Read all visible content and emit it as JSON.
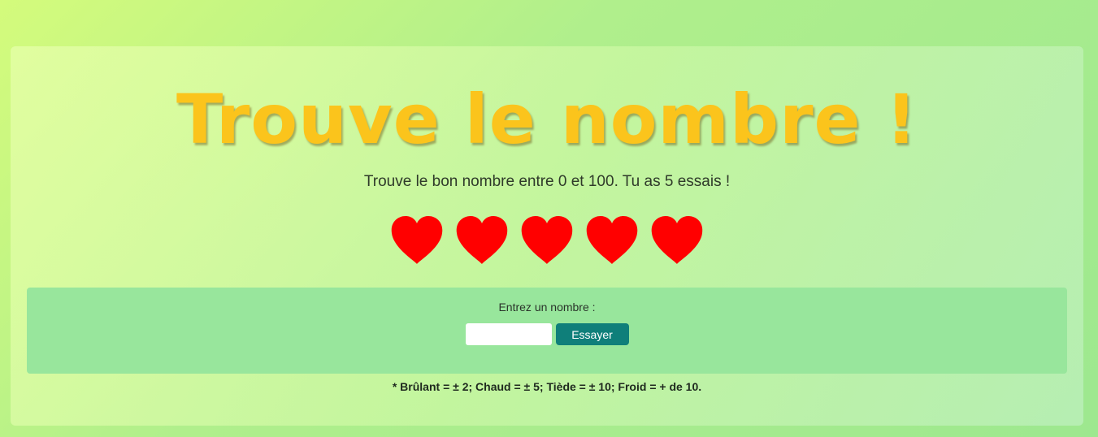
{
  "game": {
    "title": "Trouve le nombre !",
    "subtitle": "Trouve le bon nombre entre 0 et 100. Tu as 5 essais !",
    "lives": {
      "remaining": 5,
      "total": 5,
      "icon": "heart-icon",
      "color": "#ff0000"
    }
  },
  "form": {
    "prompt": "Entrez un nombre :",
    "input_value": "",
    "input_placeholder": "",
    "submit_label": "Essayer"
  },
  "legend": "* Brûlant = ± 2; Chaud = ± 5; Tiède = ± 10; Froid = + de 10.",
  "colors": {
    "title": "#fbc41c",
    "button": "#0f7f7a",
    "panel": "#98e69c"
  }
}
